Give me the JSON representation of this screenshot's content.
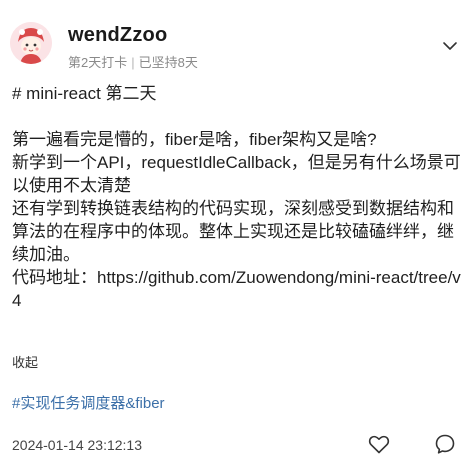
{
  "post": {
    "username": "wendZzoo",
    "checkin_day": "第2天打卡",
    "separator": "|",
    "streak": "已坚持8天",
    "title": "# mini-react 第二天",
    "paragraph_1": "第一遍看完是懵的，fiber是啥，fiber架构又是啥?",
    "paragraph_2": "新学到一个API，requestIdleCallback，但是另有什么场景可以使用不太清楚",
    "paragraph_3": "还有学到转换链表结构的代码实现，深刻感受到数据结构和算法的在程序中的体现。整体上实现还是比较磕磕绊绊，继续加油。",
    "paragraph_4": "代码地址：https://github.com/Zuowendong/mini-react/tree/v4",
    "collapse_label": "收起",
    "tag": "#实现任务调度器&fiber",
    "timestamp": "2024-01-14 23:12:13"
  },
  "icons": {
    "avatar": "avatar-image",
    "expand": "chevron-down-icon",
    "like": "heart-icon",
    "comment": "comment-icon"
  }
}
